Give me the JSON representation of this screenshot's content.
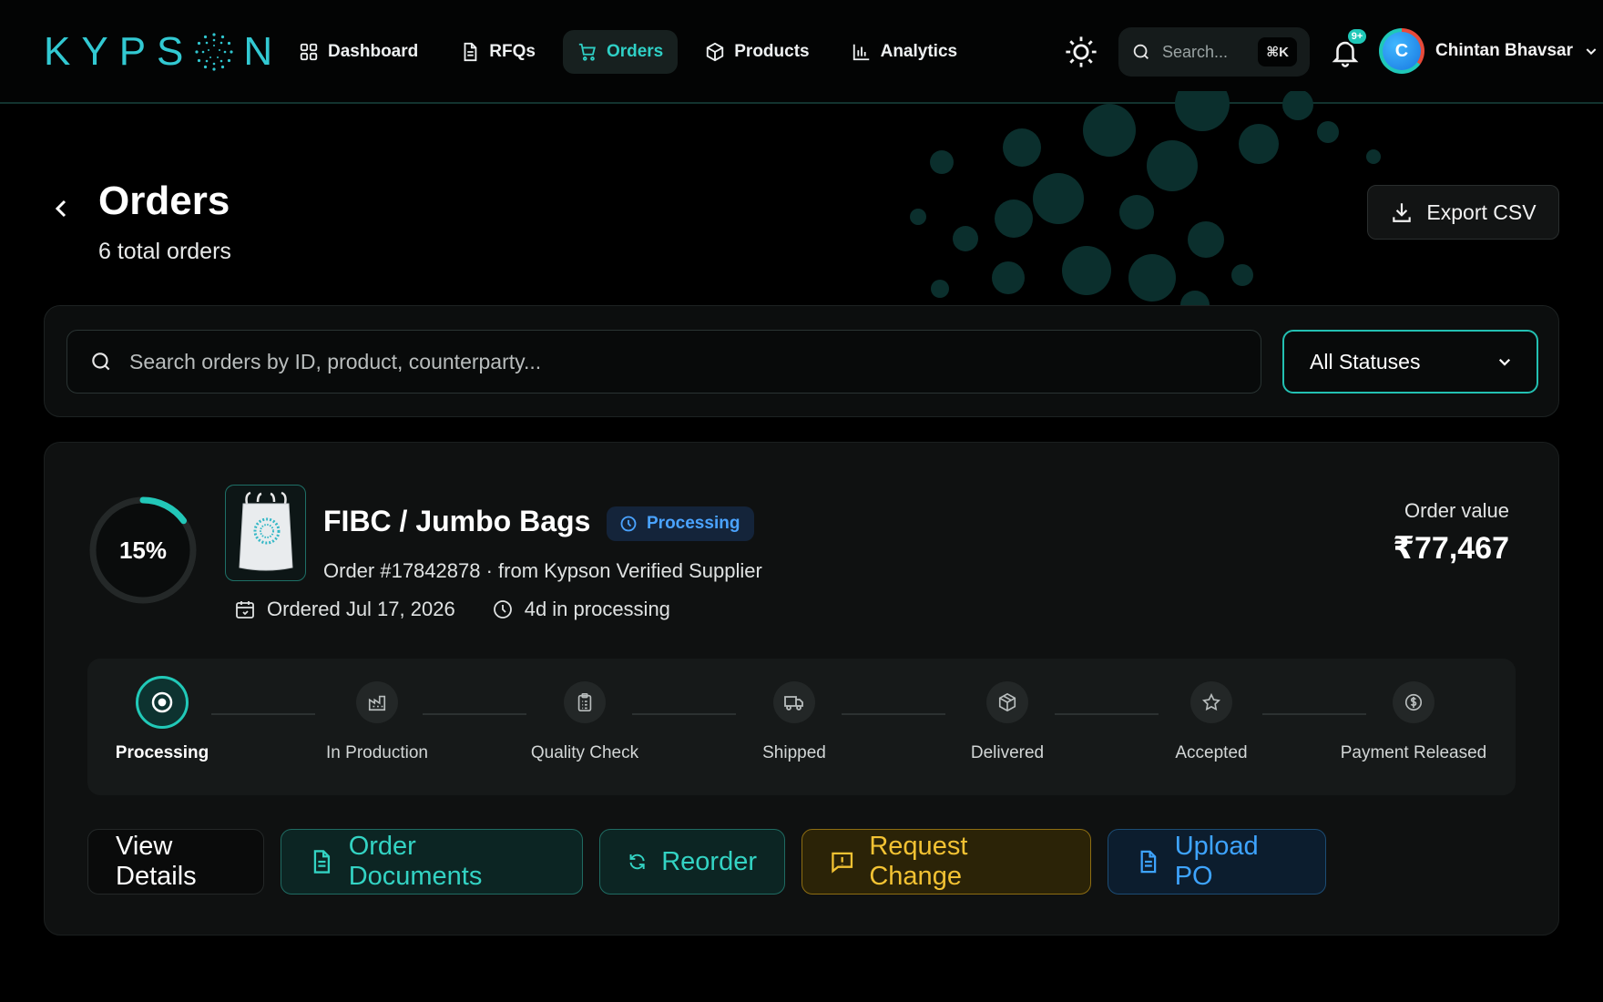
{
  "brand": {
    "logo_text_left": "KYPS",
    "logo_text_right": "N",
    "accent": "#2fd0c6"
  },
  "nav": {
    "items": [
      {
        "label": "Dashboard",
        "icon": "grid-icon"
      },
      {
        "label": "RFQs",
        "icon": "document-icon"
      },
      {
        "label": "Orders",
        "icon": "cart-icon",
        "active": true
      },
      {
        "label": "Products",
        "icon": "box-icon"
      },
      {
        "label": "Analytics",
        "icon": "bar-chart-icon"
      }
    ]
  },
  "header": {
    "search_placeholder": "Search...",
    "search_shortcut": "⌘K",
    "notification_badge": "9+",
    "user_initial": "C",
    "user_name": "Chintan Bhavsar"
  },
  "page": {
    "title": "Orders",
    "subtitle": "6 total orders",
    "export_label": "Export CSV"
  },
  "filters": {
    "search_placeholder": "Search orders by ID, product, counterparty...",
    "status_selected": "All Statuses"
  },
  "order": {
    "progress_label": "15%",
    "progress_fraction": 0.15,
    "product": "FIBC / Jumbo Bags",
    "status": "Processing",
    "status_color": "#4aa3ff",
    "meta": "Order #17842878 · from Kypson Verified Supplier",
    "ordered": "Ordered Jul 17, 2026",
    "elapsed": "4d in processing",
    "value_label": "Order value",
    "value": "₹77,467",
    "steps": [
      {
        "label": "Processing",
        "icon": "target-icon"
      },
      {
        "label": "In Production",
        "icon": "factory-icon"
      },
      {
        "label": "Quality Check",
        "icon": "clipboard-icon"
      },
      {
        "label": "Shipped",
        "icon": "truck-icon"
      },
      {
        "label": "Delivered",
        "icon": "package-icon"
      },
      {
        "label": "Accepted",
        "icon": "star-icon"
      },
      {
        "label": "Payment Released",
        "icon": "dollar-coin-icon"
      }
    ],
    "current_step": 0,
    "actions": {
      "view": "View Details",
      "docs": "Order Documents",
      "reorder": "Reorder",
      "change": "Request Change",
      "upload": "Upload PO"
    }
  }
}
